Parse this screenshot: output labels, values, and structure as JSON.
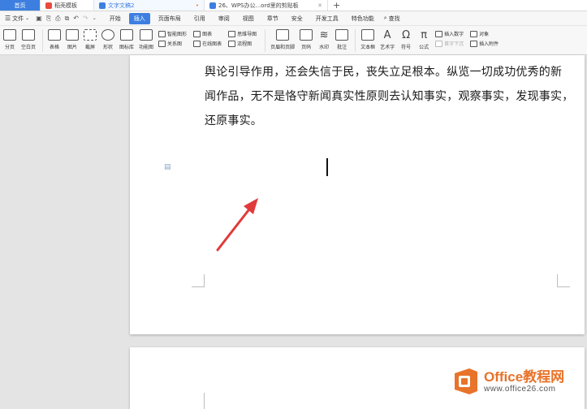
{
  "tabs": [
    {
      "label": "首页",
      "active": false
    },
    {
      "label": "稻壳模板",
      "active": false
    },
    {
      "label": "文字文稿2",
      "active": true,
      "status": "•"
    },
    {
      "label": "26、WPS办公...ord里的剪贴板",
      "active": false
    }
  ],
  "tab_add": "+",
  "menubar": {
    "file_label": "文件",
    "items": [
      "开始",
      "插入",
      "页面布局",
      "引用",
      "审阅",
      "视图",
      "章节",
      "安全",
      "开发工具",
      "特色功能"
    ],
    "active_item": "插入",
    "search_label": "查找"
  },
  "ribbon": {
    "page_break": "分页",
    "blank_page": "空白页",
    "table": "表格",
    "picture": "图片",
    "screenshot": "截屏",
    "shape": "形状",
    "icon_lib": "图标库",
    "func_chart": "功能图",
    "smart_shape": "智能图形",
    "chart": "图表",
    "relation_chart": "关系图",
    "online_chart": "在线图表",
    "mind_map": "思维导图",
    "flow_chart": "流程图",
    "header_footer": "页眉和页脚",
    "page_number": "页码",
    "watermark": "水印",
    "comment": "批注",
    "text_box": "文本框",
    "art_text": "艺术字",
    "symbol": "符号",
    "formula": "公式",
    "insert_number": "插入数字",
    "object": "对象",
    "first_letter_sink": "首字下沉",
    "insert_attachment": "插入附件"
  },
  "document": {
    "lines": [
      "舆论引导作用，还会失信于民，丧失立足根本。纵览一切成功优秀的新",
      "闻作品，无不是恪守新闻真实性原则去认知事实，观察事实，发现事实，",
      "还原事实。"
    ]
  },
  "watermark_logo": {
    "title": "Office教程网",
    "url": "www.office26.com"
  },
  "colors": {
    "accent": "#3d7fe0",
    "arrow": "#e03a3a",
    "logo_orange": "#e8732a"
  }
}
